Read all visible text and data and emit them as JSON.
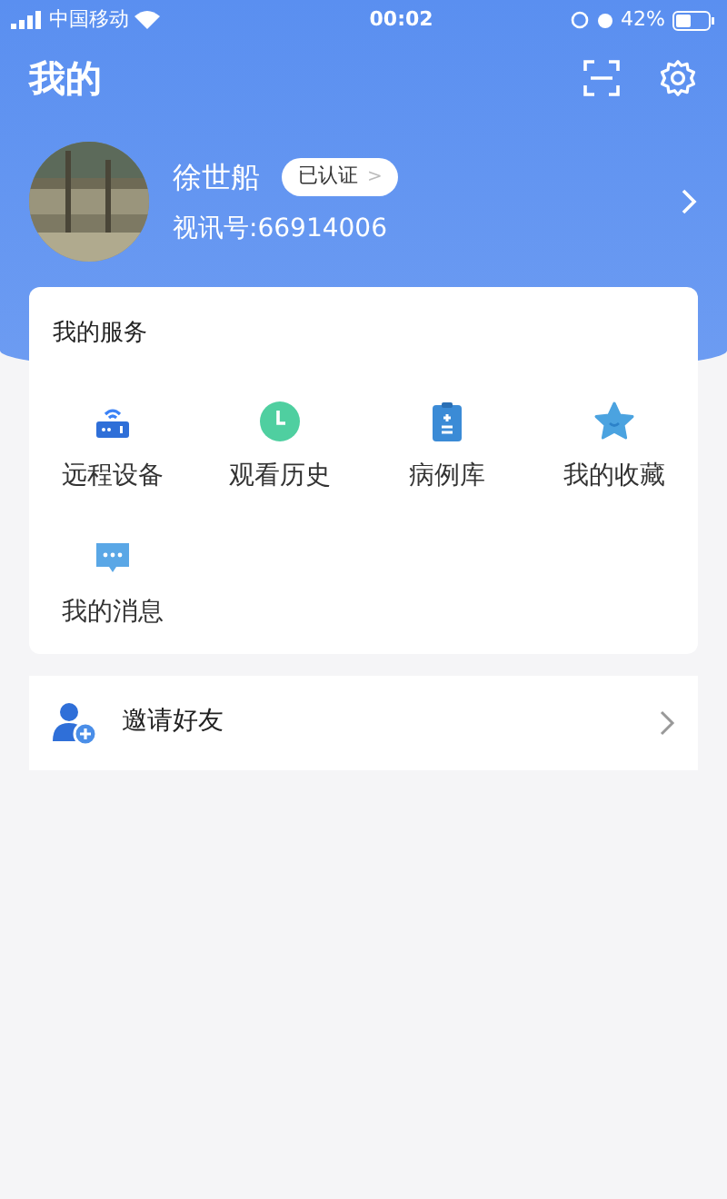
{
  "status_bar": {
    "carrier": "中国移动",
    "time": "00:02",
    "battery": "42%"
  },
  "header": {
    "title": "我的"
  },
  "profile": {
    "name": "徐世船",
    "badge": "已认证",
    "badge_arrow": ">",
    "id_text": "视讯号:66914006"
  },
  "services": {
    "title": "我的服务",
    "items": [
      {
        "kind": "router",
        "label": "远程设备"
      },
      {
        "kind": "clock",
        "label": "观看历史"
      },
      {
        "kind": "clipboard",
        "label": "病例库"
      },
      {
        "kind": "star",
        "label": "我的收藏"
      },
      {
        "kind": "message",
        "label": "我的消息"
      }
    ]
  },
  "invite": {
    "label": "邀请好友"
  }
}
